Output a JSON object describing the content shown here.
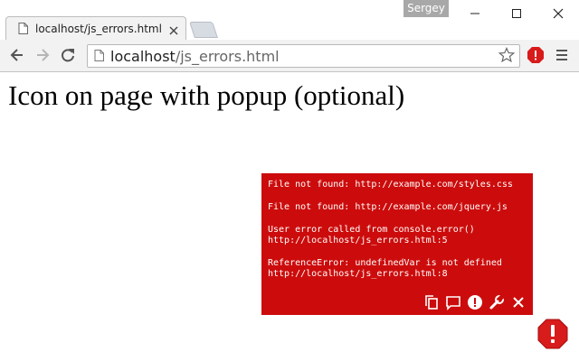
{
  "window": {
    "user_name": "Sergey"
  },
  "tab": {
    "title": "localhost/js_errors.html"
  },
  "toolbar": {
    "url_host": "localhost",
    "url_path": "/js_errors.html"
  },
  "page": {
    "heading": "Icon on page with popup (optional)"
  },
  "popup": {
    "messages": [
      {
        "line1": "File not found: http://example.com/styles.css",
        "line2": ""
      },
      {
        "line1": "File not found: http://example.com/jquery.js",
        "line2": ""
      },
      {
        "line1": "User error called from console.error()",
        "line2": "http://localhost/js_errors.html:5"
      },
      {
        "line1": "ReferenceError: undefinedVar is not defined",
        "line2": "http://localhost/js_errors.html:8"
      }
    ],
    "tools": [
      "copy-icon",
      "comment-icon",
      "alert-icon",
      "wrench-icon",
      "close-icon"
    ]
  },
  "colors": {
    "popup_background": "#cc0c0c",
    "alert_red": "#d81b1b",
    "toolbar_background": "#f2f2f2"
  }
}
